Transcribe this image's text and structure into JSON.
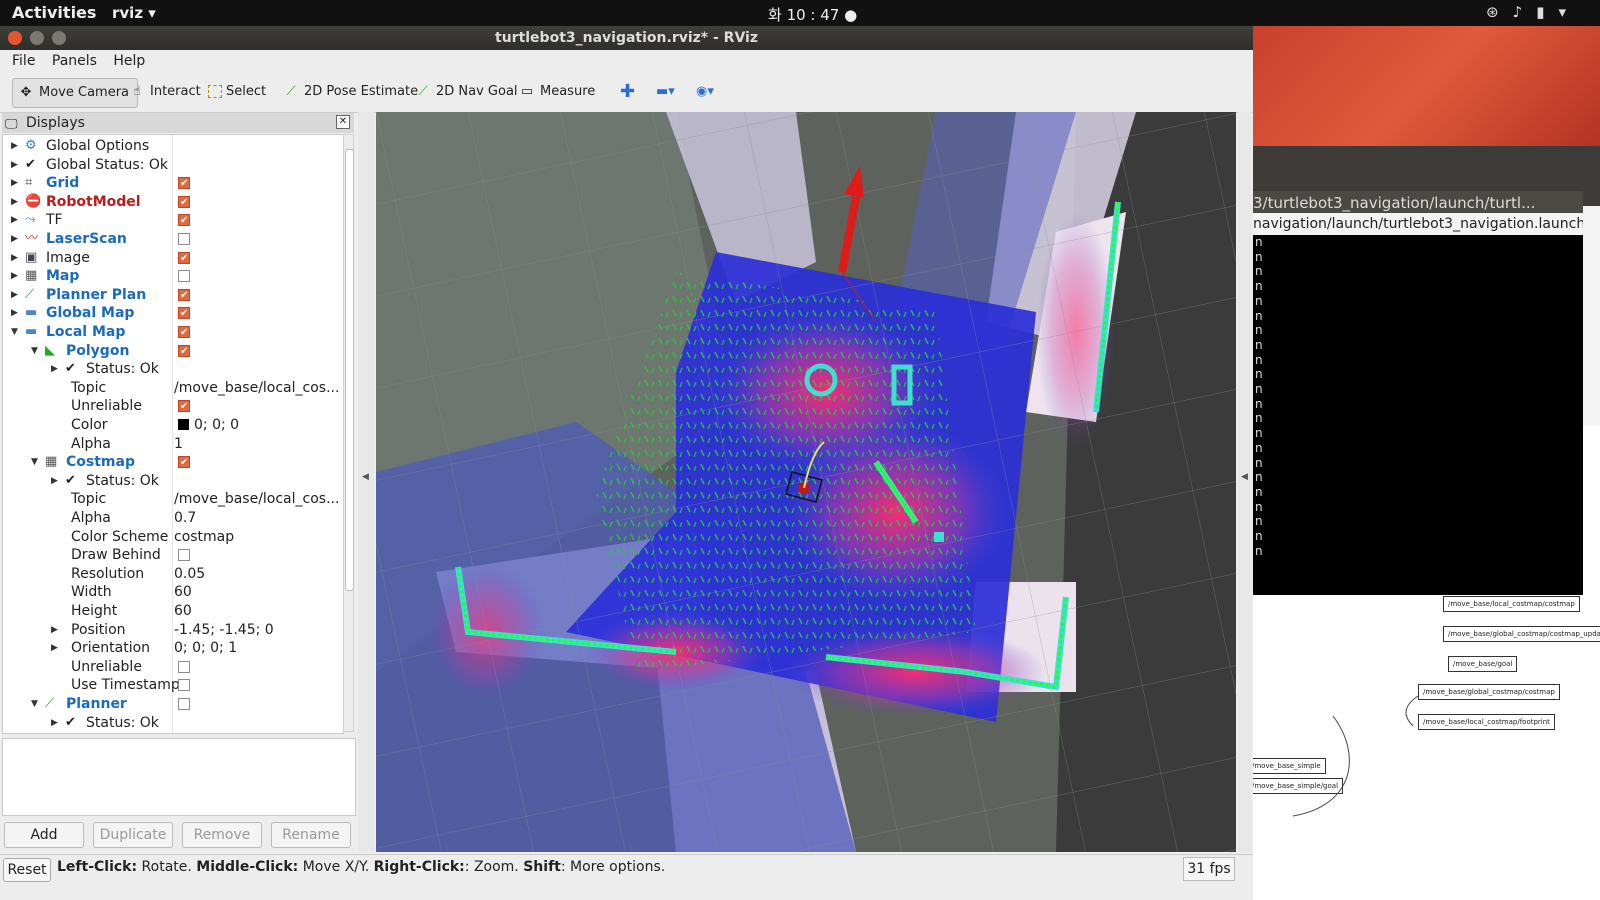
{
  "topbar": {
    "activities": "Activities",
    "app": "rviz ▾",
    "clock": "화 10 : 47 ●"
  },
  "window": {
    "title": "turtlebot3_navigation.rviz* - RViz"
  },
  "menu": {
    "file": "File",
    "panels": "Panels",
    "help": "Help"
  },
  "toolbar": {
    "move_camera": "Move Camera",
    "interact": "Interact",
    "select": "Select",
    "pose_estimate": "2D Pose Estimate",
    "nav_goal": "2D Nav Goal",
    "measure": "Measure"
  },
  "displays": {
    "title": "Displays",
    "rows": [
      {
        "label": "Global Options"
      },
      {
        "label": "Global Status: Ok"
      },
      {
        "label": "Grid"
      },
      {
        "label": "RobotModel"
      },
      {
        "label": "TF"
      },
      {
        "label": "LaserScan"
      },
      {
        "label": "Image"
      },
      {
        "label": "Map"
      },
      {
        "label": "Planner Plan"
      },
      {
        "label": "Global Map"
      },
      {
        "label": "Local Map"
      },
      {
        "label": "Polygon"
      },
      {
        "label": "Status: Ok"
      },
      {
        "label": "Topic",
        "value": "/move_base/local_cos..."
      },
      {
        "label": "Unreliable"
      },
      {
        "label": "Color",
        "value": "0; 0; 0"
      },
      {
        "label": "Alpha",
        "value": "1"
      },
      {
        "label": "Costmap"
      },
      {
        "label": "Status: Ok"
      },
      {
        "label": "Topic",
        "value": "/move_base/local_cos..."
      },
      {
        "label": "Alpha",
        "value": "0.7"
      },
      {
        "label": "Color Scheme",
        "value": "costmap"
      },
      {
        "label": "Draw Behind"
      },
      {
        "label": "Resolution",
        "value": "0.05"
      },
      {
        "label": "Width",
        "value": "60"
      },
      {
        "label": "Height",
        "value": "60"
      },
      {
        "label": "Position",
        "value": "-1.45; -1.45; 0"
      },
      {
        "label": "Orientation",
        "value": "0; 0; 0; 1"
      },
      {
        "label": "Unreliable"
      },
      {
        "label": "Use Timestamp"
      },
      {
        "label": "Planner"
      },
      {
        "label": "Status: Ok"
      }
    ],
    "checked": [
      true,
      true,
      true,
      false,
      true,
      false,
      true,
      true,
      true,
      true,
      true,
      true,
      false,
      false,
      false,
      false
    ],
    "buttons": {
      "add": "Add",
      "duplicate": "Duplicate",
      "remove": "Remove",
      "rename": "Rename"
    }
  },
  "statusbar": {
    "reset": "Reset",
    "hint_lc": "Left-Click:",
    "hint_lc_t": " Rotate. ",
    "hint_mc": "Middle-Click:",
    "hint_mc_t": " Move X/Y. ",
    "hint_rc": "Right-Click:",
    "hint_rc_t": ": Zoom. ",
    "hint_sh": "Shift",
    "hint_sh_t": ": More options.",
    "fps": "31 fps"
  },
  "terminal": {
    "title": "3/turtlebot3_navigation/launch/turtl...",
    "path": "navigation/launch/turtlebot3_navigation.launch",
    "lines": [
      "n",
      "n",
      "n",
      "n",
      "n",
      "n",
      "n",
      "n",
      "n",
      "n",
      "n",
      "n",
      "n",
      "n",
      "n",
      "n",
      "n",
      "n",
      "n",
      "n",
      "n",
      "n"
    ]
  },
  "rqt": {
    "nodes": [
      "/move_base/local_costmap/costmap",
      "/move_base/global_costmap/costmap_updates",
      "/move_base/goal",
      "/move_base/global_costmap/costmap",
      "/move_base/local_costmap/footprint",
      "/move_base_simple",
      "/move_base_simple/goal"
    ]
  },
  "colors": {
    "accent": "#e7673c",
    "link_blue": "#1a6bbd",
    "error_red": "#c01a1a",
    "ok_green": "#2a9a2a"
  }
}
